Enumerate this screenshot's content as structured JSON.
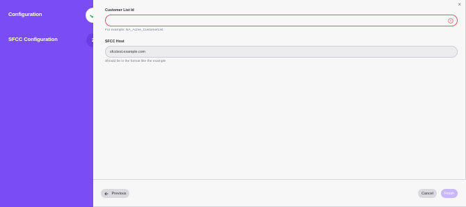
{
  "sidebar": {
    "steps": [
      {
        "label": "Configuration",
        "status": "complete",
        "indicator": "check-icon"
      },
      {
        "label": "SFCC Configuration",
        "status": "current",
        "number": "2"
      }
    ],
    "colors": {
      "background": "#7a4df4",
      "current_circle": "#6a3de8",
      "check": "#3fb56b"
    }
  },
  "dialog": {
    "close_symbol": "×",
    "fields": [
      {
        "label": "Customer List Id",
        "value": "",
        "hint": "For example: NA_Acme_CustomerList",
        "state": "error",
        "error_icon": "alert-circle-icon"
      },
      {
        "label": "SFCC Host",
        "value": "sfcctest.example.com",
        "hint": "Should be in the format like the example",
        "state": "normal"
      }
    ],
    "colors": {
      "error_border": "#d9576a"
    }
  },
  "footer": {
    "previous_label": "Previous",
    "previous_icon": "arrow-left-icon",
    "cancel_label": "Cancel",
    "finish_label": "Finish",
    "finish_disabled": true
  }
}
